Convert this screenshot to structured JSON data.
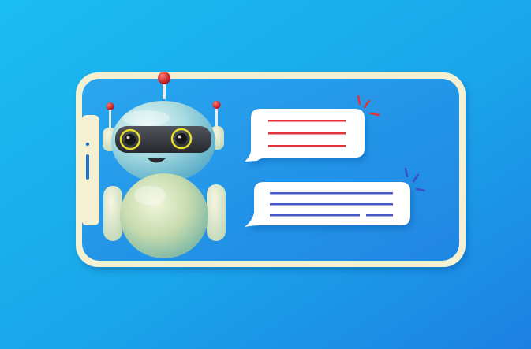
{
  "colors": {
    "background_start": "#18b8ec",
    "background_end": "#1c86e4",
    "phone_frame": "#f4f3d6",
    "phone_screen": "#2a9ae9",
    "bubble": "#ffffff",
    "chat_lines_top": "#e8343a",
    "chat_lines_bottom": "#4456c8",
    "robot_head": "#9fd6df",
    "robot_visor": "#3a3d44",
    "robot_eye_ring": "#e7dd2a",
    "robot_body": "#c8dcb0",
    "antenna_tip": "#d8191f"
  },
  "icons": {
    "robot": "robot-icon",
    "phone": "phone-icon",
    "chat_bubble": "chat-bubble-icon",
    "sparkle": "sparkle-icon"
  }
}
